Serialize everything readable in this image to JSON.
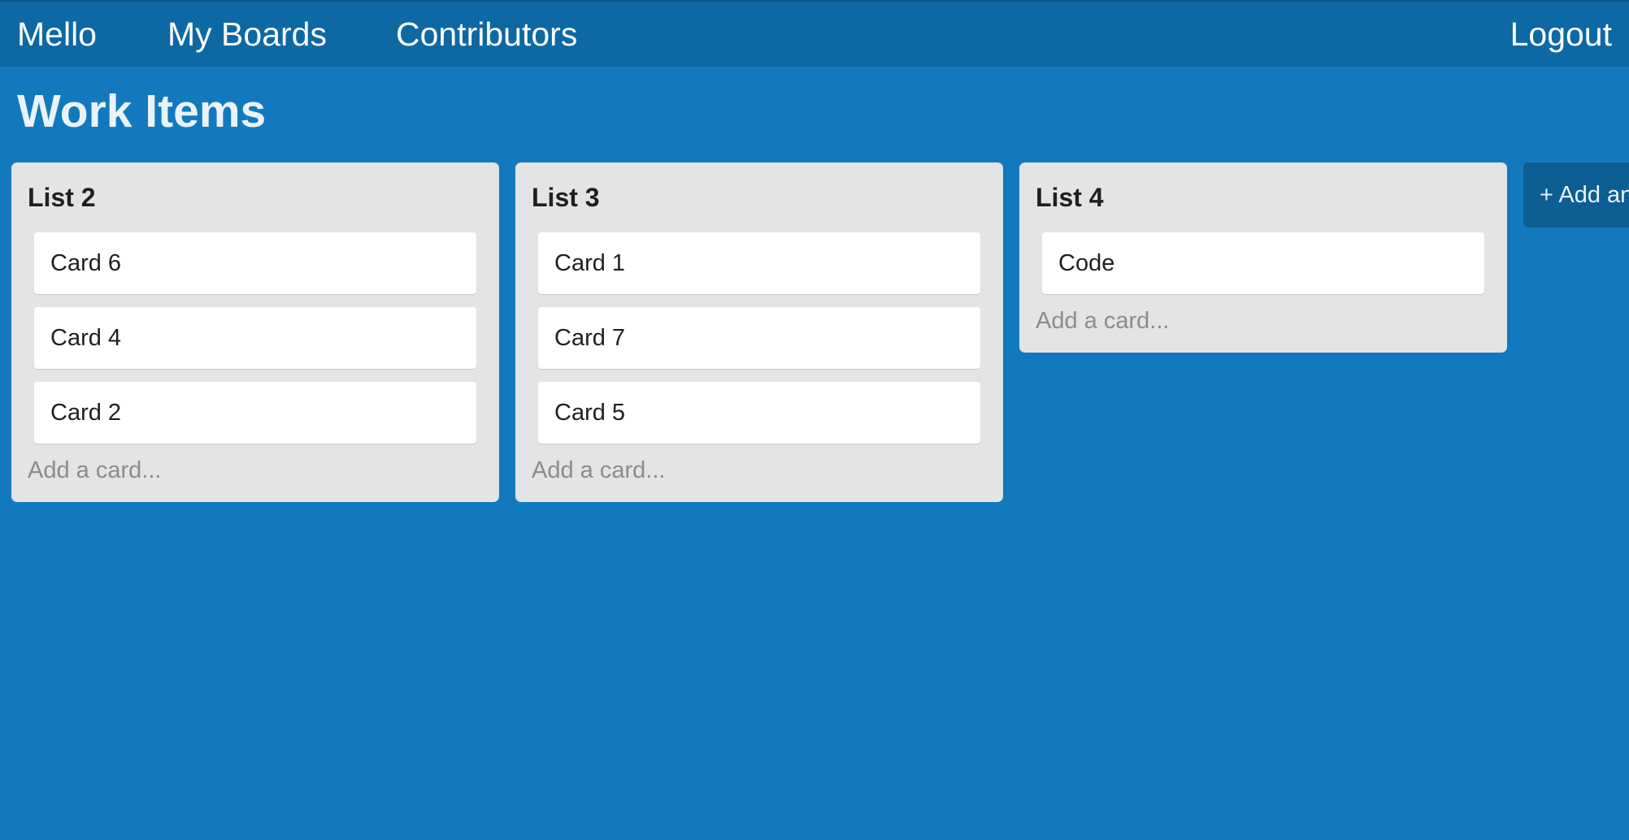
{
  "navbar": {
    "brand": "Mello",
    "my_boards": "My Boards",
    "contributors": "Contributors",
    "logout": "Logout"
  },
  "board": {
    "title": "Work Items"
  },
  "lists": [
    {
      "title": "List 2",
      "cards": [
        "Card 6",
        "Card 4",
        "Card 2"
      ],
      "add_card": "Add a card..."
    },
    {
      "title": "List 3",
      "cards": [
        "Card 1",
        "Card 7",
        "Card 5"
      ],
      "add_card": "Add a card..."
    },
    {
      "title": "List 4",
      "cards": [
        "Code"
      ],
      "add_card": "Add a card..."
    }
  ],
  "add_list": {
    "label": "+ Add an"
  },
  "colors": {
    "background": "#1379be",
    "navbar": "#0d68a3",
    "list": "#e2e4e6",
    "card": "#ffffff",
    "add_list_button": "#0d5e93"
  }
}
